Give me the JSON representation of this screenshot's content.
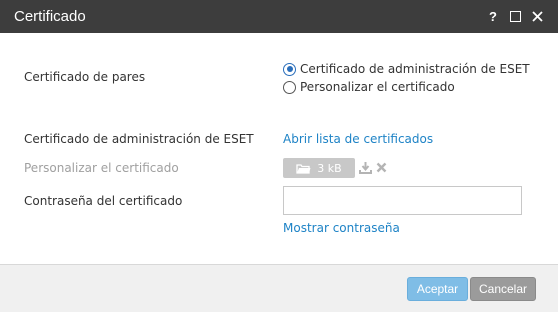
{
  "window": {
    "title": "Certificado",
    "help_icon": "question-mark-icon",
    "maximize_icon": "maximize-icon",
    "close_icon": "close-icon"
  },
  "form": {
    "peer_cert_label": "Certificado de pares",
    "options": [
      {
        "label": "Certificado de administración de ESET",
        "selected": true
      },
      {
        "label": "Personalizar el certificado",
        "selected": false
      }
    ],
    "eset_cert_label": "Certificado de administración de ESET",
    "open_cert_list_link": "Abrir lista de certificados",
    "custom_cert_label": "Personalizar el certificado",
    "file_size": "3 kB",
    "password_label": "Contraseña del certificado",
    "password_value": "",
    "show_password_link": "Mostrar contraseña"
  },
  "footer": {
    "accept_label": "Aceptar",
    "cancel_label": "Cancelar"
  },
  "colors": {
    "titlebar": "#3d3d3d",
    "link": "#1e83c6",
    "accept": "#7fbde6",
    "cancel": "#9b9b9b"
  }
}
